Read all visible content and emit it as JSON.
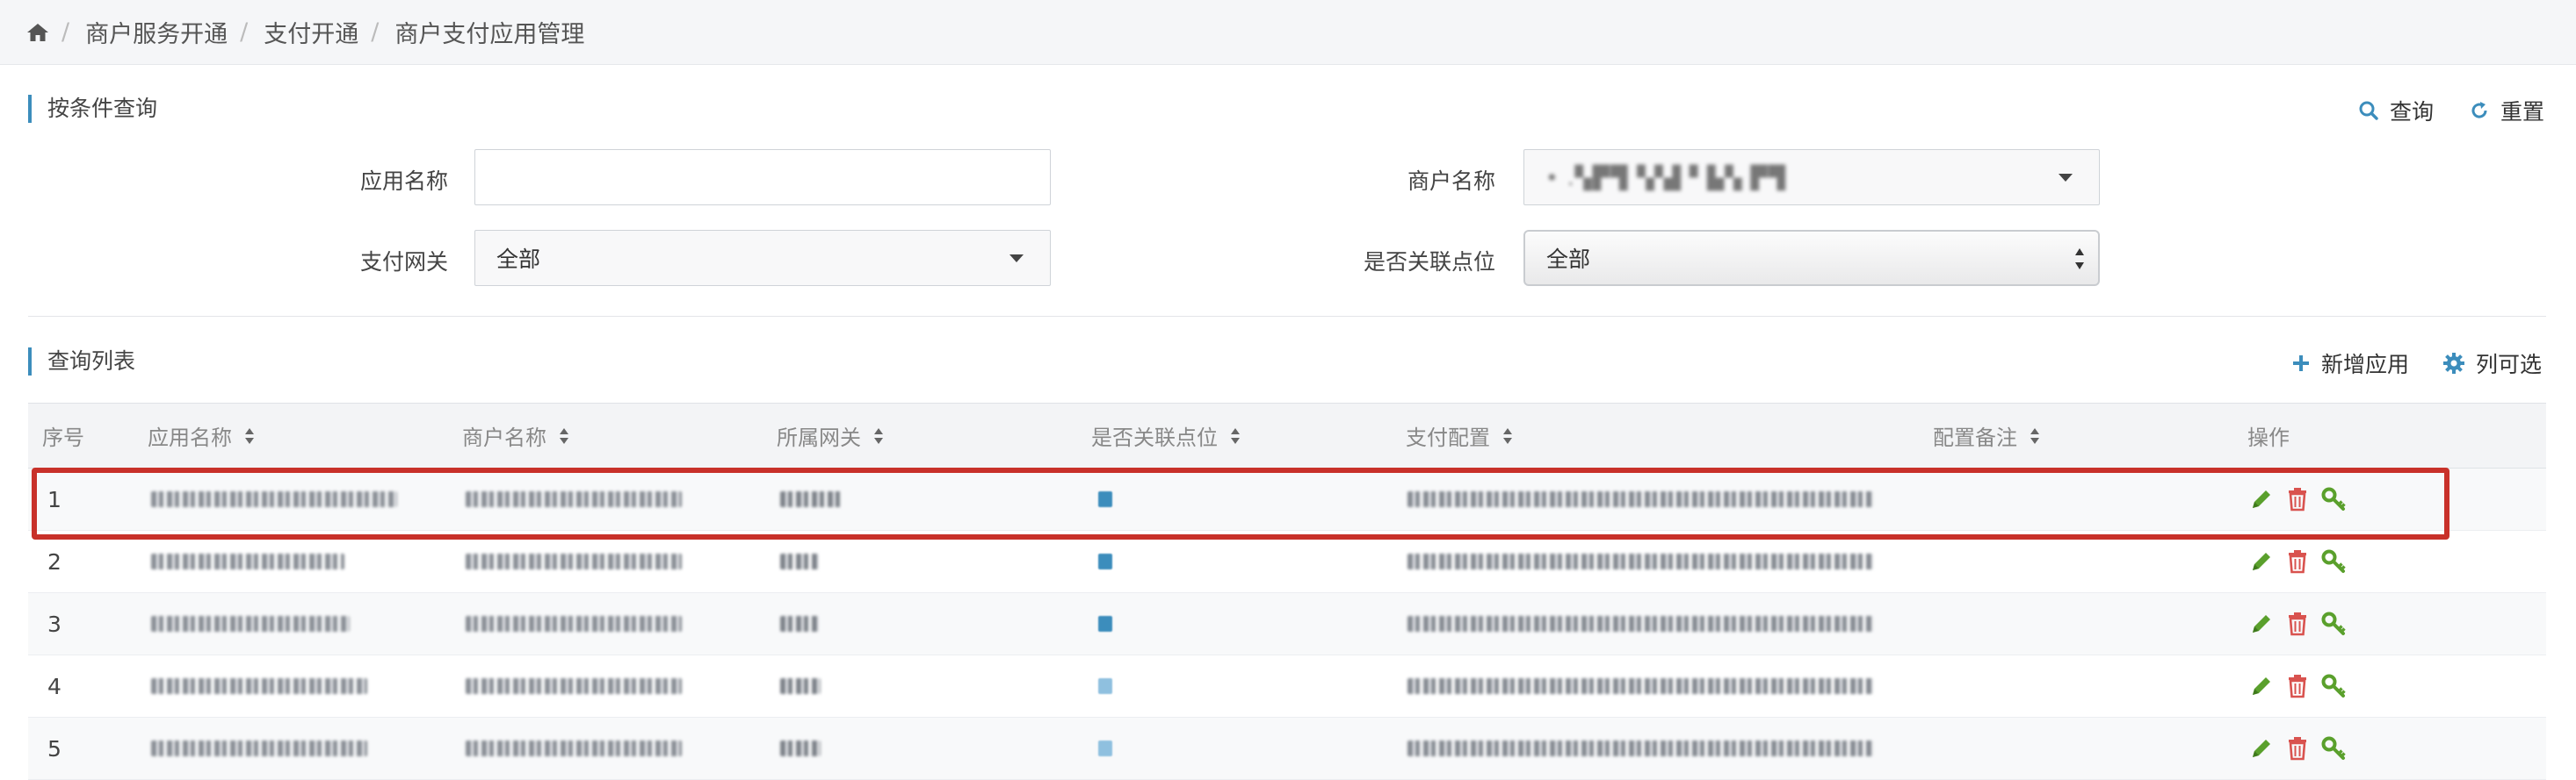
{
  "breadcrumb": {
    "home_icon": "home-icon",
    "items": [
      "商户服务开通",
      "支付开通",
      "商户支付应用管理"
    ]
  },
  "query": {
    "title": "按条件查询",
    "search_label": "查询",
    "reset_label": "重置",
    "fields": {
      "app_name_label": "应用名称",
      "app_name_value": "",
      "merchant_label": "商户名称",
      "merchant_value": "• .▚▛▜▝▞▟ ▘▙▚ ▛▜",
      "gateway_label": "支付网关",
      "gateway_value": "全部",
      "linked_label": "是否关联点位",
      "linked_value": "全部"
    }
  },
  "list": {
    "title": "查询列表",
    "add_label": "新增应用",
    "columns_label": "列可选",
    "headers": [
      "序号",
      "应用名称",
      "商户名称",
      "所属网关",
      "是否关联点位",
      "支付配置",
      "配置备注",
      "操作"
    ],
    "rows": [
      {
        "index": "1"
      },
      {
        "index": "2"
      },
      {
        "index": "3"
      },
      {
        "index": "4"
      },
      {
        "index": "5"
      }
    ]
  },
  "colors": {
    "accent": "#3c8dbc",
    "edit": "#5aa02c",
    "delete": "#d9534f",
    "key": "#5aa02c",
    "highlight": "#c8312a"
  }
}
